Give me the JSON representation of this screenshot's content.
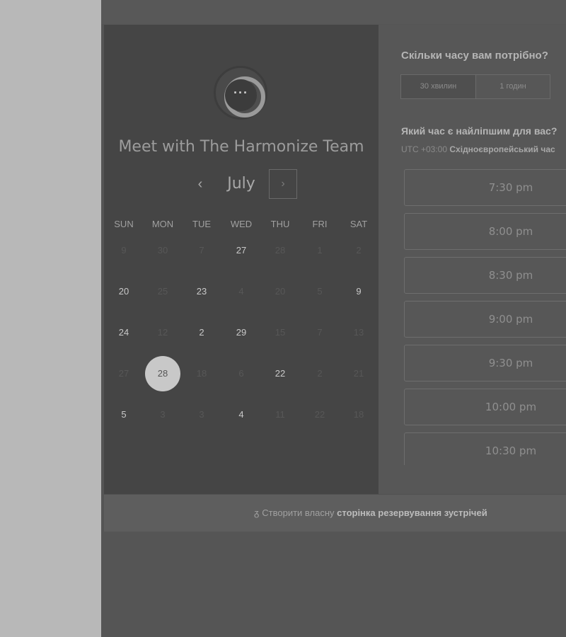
{
  "booking": {
    "title": "Meet with The Harmonize Team",
    "avatar_icon": "chat-bubble-dots-icon",
    "month": "July",
    "prev_glyph": "‹",
    "next_glyph": "›",
    "weekdays": [
      "SUN",
      "MON",
      "TUE",
      "WED",
      "THU",
      "FRI",
      "SAT"
    ],
    "weeks": [
      [
        {
          "d": "9",
          "a": false
        },
        {
          "d": "30",
          "a": false
        },
        {
          "d": "7",
          "a": false
        },
        {
          "d": "27",
          "a": true
        },
        {
          "d": "28",
          "a": false
        },
        {
          "d": "1",
          "a": false
        },
        {
          "d": "2",
          "a": false
        }
      ],
      [
        {
          "d": "20",
          "a": true
        },
        {
          "d": "25",
          "a": false
        },
        {
          "d": "23",
          "a": true
        },
        {
          "d": "4",
          "a": false
        },
        {
          "d": "20",
          "a": false
        },
        {
          "d": "5",
          "a": false
        },
        {
          "d": "9",
          "a": true
        }
      ],
      [
        {
          "d": "24",
          "a": true
        },
        {
          "d": "12",
          "a": false
        },
        {
          "d": "2",
          "a": true
        },
        {
          "d": "29",
          "a": true
        },
        {
          "d": "15",
          "a": false
        },
        {
          "d": "7",
          "a": false
        },
        {
          "d": "13",
          "a": false
        }
      ],
      [
        {
          "d": "27",
          "a": false
        },
        {
          "d": "28",
          "a": true,
          "selected": true
        },
        {
          "d": "18",
          "a": false
        },
        {
          "d": "6",
          "a": false
        },
        {
          "d": "22",
          "a": true
        },
        {
          "d": "2",
          "a": false
        },
        {
          "d": "21",
          "a": false
        }
      ],
      [
        {
          "d": "5",
          "a": true
        },
        {
          "d": "3",
          "a": false
        },
        {
          "d": "3",
          "a": false
        },
        {
          "d": "4",
          "a": true
        },
        {
          "d": "11",
          "a": false
        },
        {
          "d": "22",
          "a": false
        },
        {
          "d": "18",
          "a": false
        }
      ]
    ]
  },
  "scheduler": {
    "duration_question": "Скільки часу вам потрібно?",
    "durations": [
      "30 хвилин",
      "1 годин"
    ],
    "selected_duration": "30 хвилин",
    "time_question": "Який час є найліпшим для вас?",
    "timezone_offset": "UTC +03:00",
    "timezone_name": "Східноєвропейський час",
    "slots": [
      "7:30 pm",
      "8:00 pm",
      "8:30 pm",
      "9:00 pm",
      "9:30 pm",
      "10:00 pm",
      "10:30 pm"
    ]
  },
  "footer": {
    "icon": "sprocket-logo-icon",
    "prefix": "Створити власну",
    "link": "сторінка резервування зустрічей"
  },
  "colors": {
    "overlay": "#555555",
    "calendar_panel": "#454545",
    "selected_day": "#c8c8c8"
  }
}
